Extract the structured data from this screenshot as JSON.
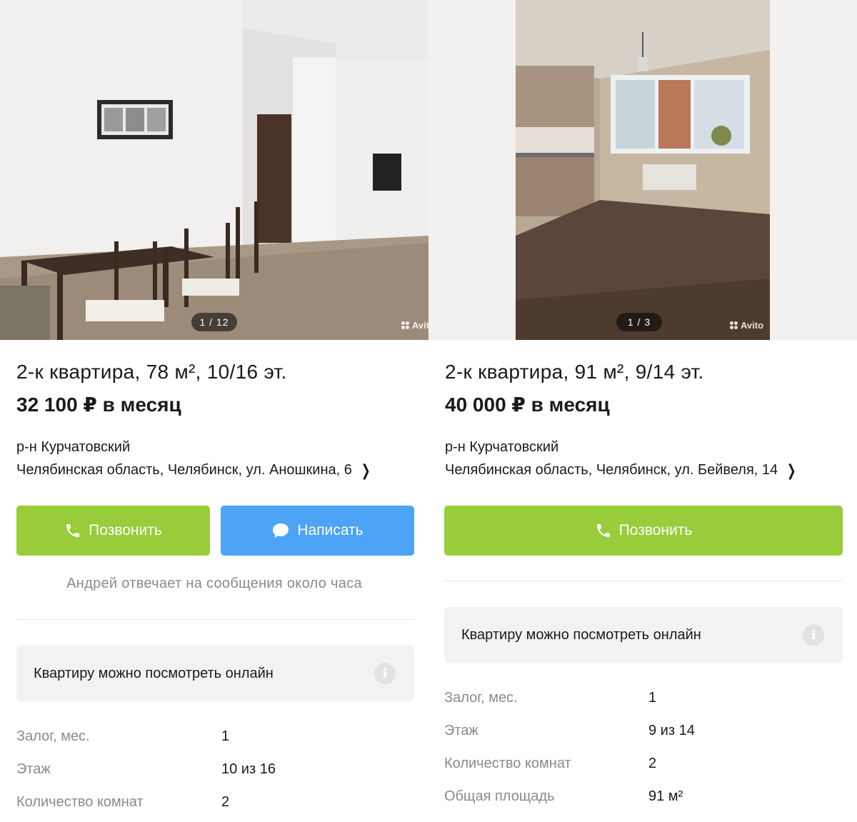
{
  "listings": [
    {
      "photo_counter": "1 / 12",
      "watermark": "Avito",
      "title": "2-к квартира, 78 м², 10/16 эт.",
      "price": "32 100 ₽ в месяц",
      "district": "р-н Курчатовский",
      "address": "Челябинская область, Челябинск, ул. Аношкина, 6",
      "call_label": "Позвонить",
      "message_label": "Написать",
      "reply_note": "Андрей отвечает на сообщения около часа",
      "online_note": "Квартиру можно посмотреть онлайн",
      "params": [
        {
          "label": "Залог, мес.",
          "value": "1"
        },
        {
          "label": "Этаж",
          "value": "10 из 16"
        },
        {
          "label": "Количество комнат",
          "value": "2"
        }
      ]
    },
    {
      "photo_counter": "1 / 3",
      "watermark": "Avito",
      "title": "2-к квартира, 91 м², 9/14 эт.",
      "price": "40 000 ₽ в месяц",
      "district": "р-н Курчатовский",
      "address": "Челябинская область, Челябинск, ул. Бейвеля, 14",
      "call_label": "Позвонить",
      "online_note": "Квартиру можно посмотреть онлайн",
      "params": [
        {
          "label": "Залог, мес.",
          "value": "1"
        },
        {
          "label": "Этаж",
          "value": "9 из 14"
        },
        {
          "label": "Количество комнат",
          "value": "2"
        },
        {
          "label": "Общая площадь",
          "value": "91 м²"
        }
      ]
    }
  ],
  "colors": {
    "call_button": "#99cc3a",
    "message_button": "#4da3f5",
    "muted_text": "#8a8a8a",
    "panel_bg": "#f2f2f2"
  },
  "icons": [
    "phone-icon",
    "chat-bubble-icon",
    "info-icon",
    "chevron-right-icon",
    "avito-logo-icon"
  ]
}
